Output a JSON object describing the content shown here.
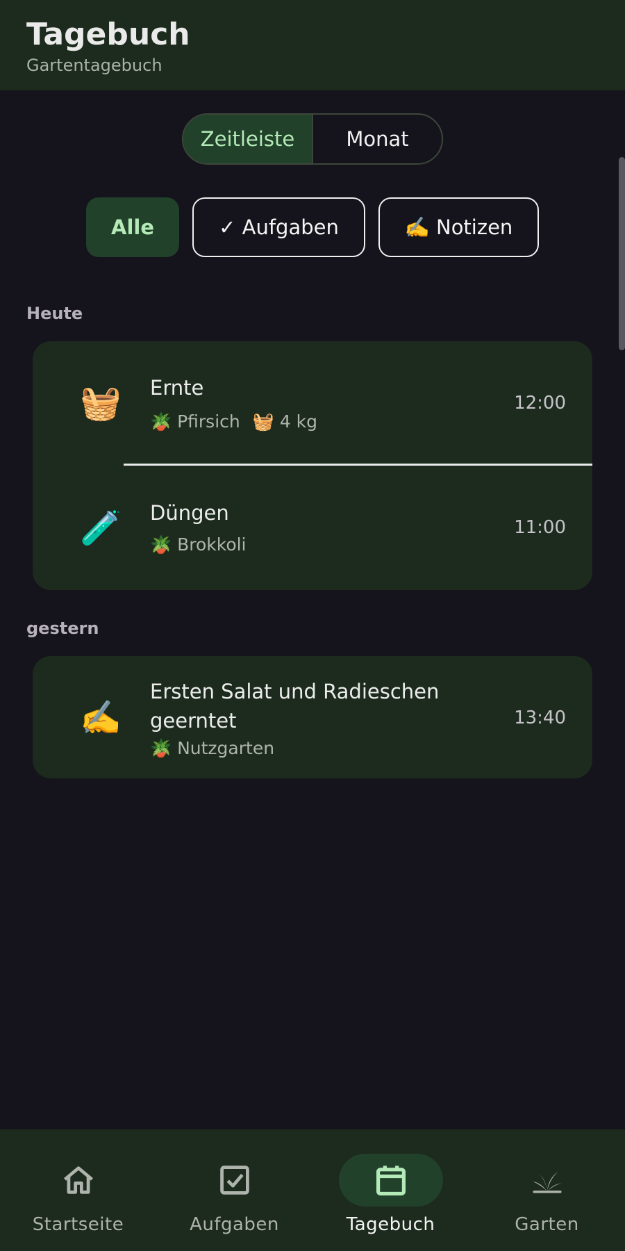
{
  "header": {
    "title": "Tagebuch",
    "subtitle": "Gartentagebuch"
  },
  "view_toggle": {
    "options": [
      "Zeitleiste",
      "Monat"
    ],
    "selected": "Zeitleiste"
  },
  "filters": [
    {
      "label": "Alle",
      "selected": true
    },
    {
      "label": "✓ Aufgaben",
      "selected": false
    },
    {
      "label": "✍️ Notizen",
      "selected": false
    }
  ],
  "sections": [
    {
      "label": "Heute",
      "entries": [
        {
          "icon": "basket-icon",
          "icon_glyph": "🧺",
          "title": "Ernte",
          "meta": "🪴 Pfirsich",
          "meta2": "🧺 4 kg",
          "time": "12:00"
        },
        {
          "icon": "test-tube-icon",
          "icon_glyph": "🧪",
          "title": "Düngen",
          "meta": "🪴 Brokkoli",
          "time": "11:00"
        }
      ]
    },
    {
      "label": "gestern",
      "entries": [
        {
          "icon": "writing-hand-icon",
          "icon_glyph": "✍️",
          "title_line1": "Ersten Salat und Radieschen",
          "title_line2": "geerntet",
          "meta": "🪴 Nutzgarten",
          "time": "13:40"
        }
      ]
    }
  ],
  "bottom_nav": [
    {
      "label": "Startseite",
      "icon": "home-icon",
      "active": false
    },
    {
      "label": "Aufgaben",
      "icon": "checkbox-icon",
      "active": false
    },
    {
      "label": "Tagebuch",
      "icon": "calendar-icon",
      "active": true
    },
    {
      "label": "Garten",
      "icon": "plant-icon",
      "active": false
    }
  ],
  "colors": {
    "background": "#15131b",
    "surface": "#1c2b1d",
    "accent_container": "#22412a",
    "accent_text": "#b4eab8"
  }
}
